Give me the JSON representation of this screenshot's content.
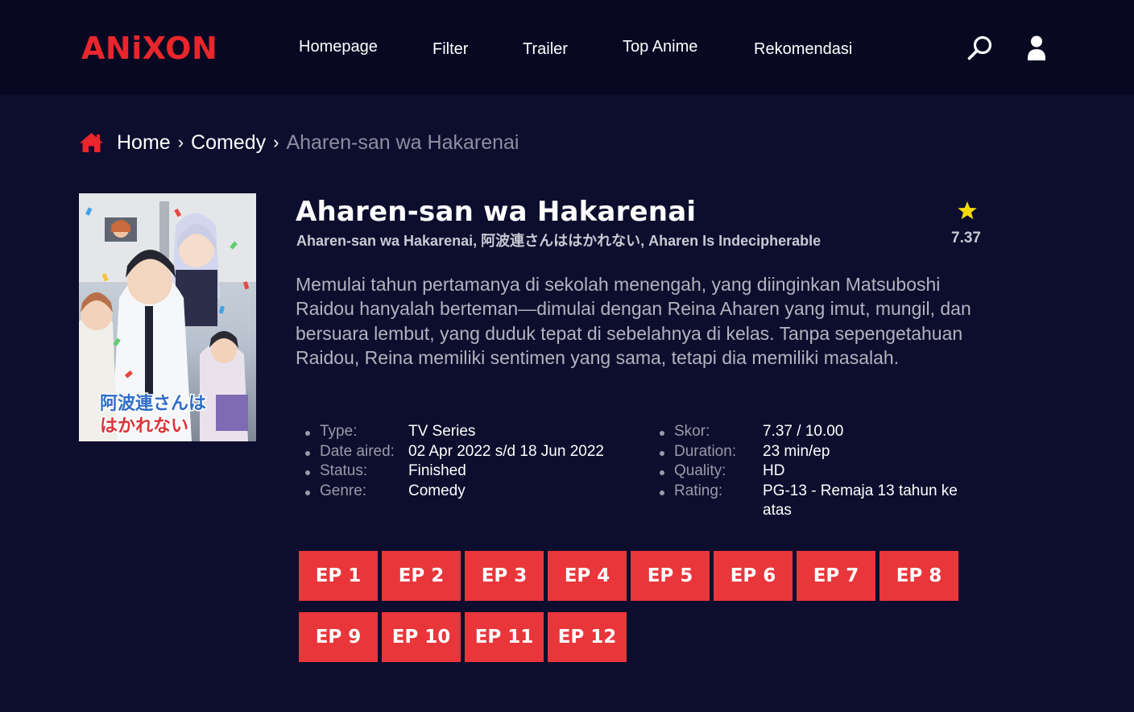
{
  "header": {
    "logo": "ANiXON",
    "nav": [
      "Homepage",
      "Filter",
      "Trailer",
      "Top Anime",
      "Rekomendasi"
    ],
    "icons": [
      "search-icon",
      "user-icon"
    ]
  },
  "breadcrumb": {
    "home": "Home",
    "category": "Comedy",
    "current": "Aharen-san wa Hakarenai",
    "home_icon": "home-icon"
  },
  "anime": {
    "title": "Aharen-san wa Hakarenai",
    "alt_titles": "Aharen-san wa Hakarenai, 阿波連さんははかれない, Aharen Is Indecipherable",
    "score": "7.37",
    "synopsis": "Memulai tahun pertamanya di sekolah menengah, yang diinginkan Matsuboshi Raidou hanyalah berteman—dimulai dengan Reina Aharen yang imut, mungil, dan bersuara lembut, yang duduk tepat di sebelahnya di kelas. Tanpa sepengetahuan Raidou, Reina memiliki sentimen yang sama, tetapi dia memiliki masalah.",
    "poster_text": [
      "阿波連さんは",
      "はかれない"
    ]
  },
  "info_left": [
    {
      "label": "Type:",
      "value": "TV Series"
    },
    {
      "label": "Date aired:",
      "value": "02 Apr 2022 s/d 18 Jun 2022"
    },
    {
      "label": "Status:",
      "value": "Finished"
    },
    {
      "label": "Genre:",
      "value": "Comedy"
    }
  ],
  "info_right": [
    {
      "label": "Skor:",
      "value": "7.37 / 10.00"
    },
    {
      "label": "Duration:",
      "value": "23 min/ep"
    },
    {
      "label": "Quality:",
      "value": "HD"
    },
    {
      "label": "Rating:",
      "value": "PG-13 - Remaja 13 tahun ke atas"
    }
  ],
  "episodes": [
    "EP 1",
    "EP 2",
    "EP 3",
    "EP 4",
    "EP 5",
    "EP 6",
    "EP 7",
    "EP 8",
    "EP 9",
    "EP 10",
    "EP 11",
    "EP 12"
  ],
  "colors": {
    "background": "#0d0d2d",
    "header": "#080822",
    "accent": "#e8262c",
    "episode_button": "#e8363b",
    "star": "#f5d90a"
  }
}
